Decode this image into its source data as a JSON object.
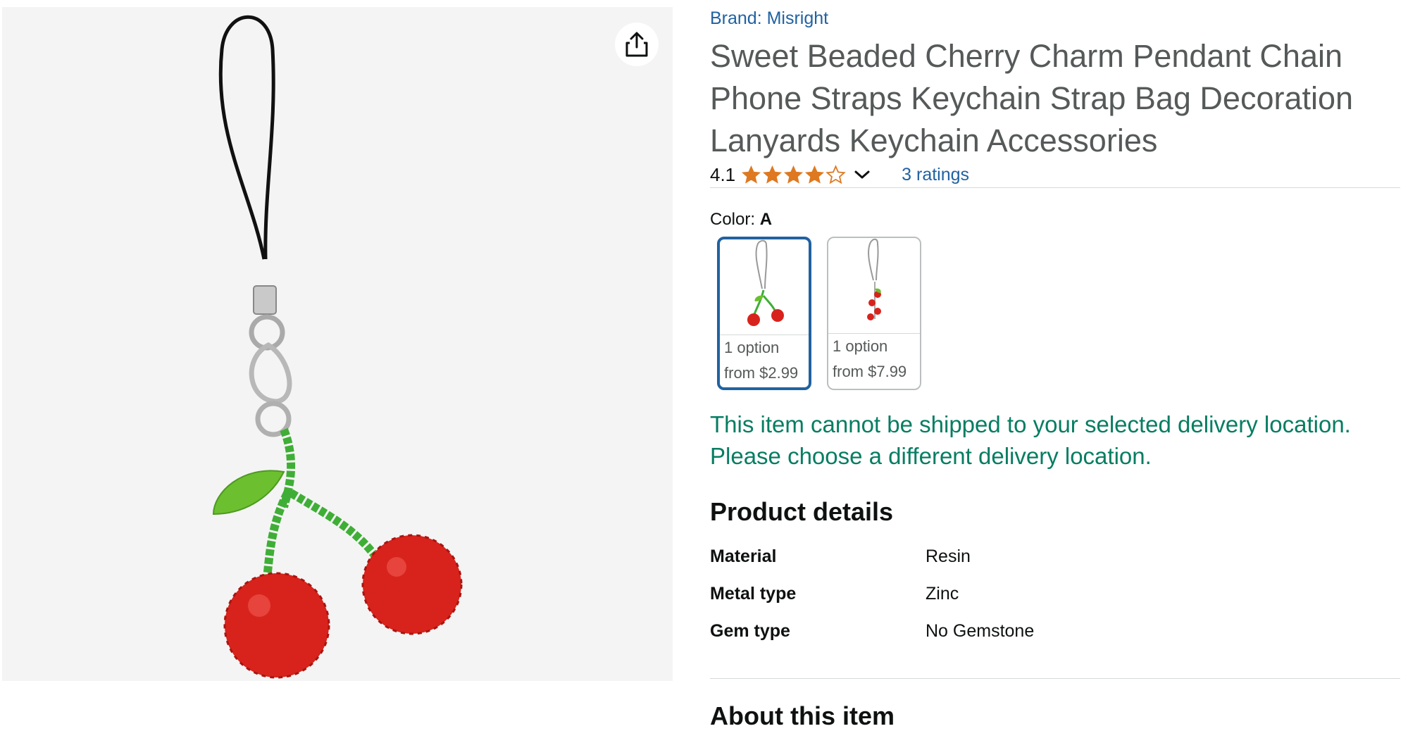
{
  "product": {
    "brand": "Brand: Misright",
    "title": "Sweet Beaded Cherry Charm Pendant Chain Phone Straps Keychain Strap Bag Decoration Lanyards Keychain Accessories",
    "rating": "4.1",
    "stars_filled": 4,
    "stars_total": 5,
    "ratings_count": "3 ratings"
  },
  "color": {
    "label": "Color:",
    "selected": "A",
    "swatches": [
      {
        "options": "1 option",
        "price": "from $2.99",
        "selected": true
      },
      {
        "options": "1 option",
        "price": "from $7.99",
        "selected": false
      }
    ]
  },
  "shipping": {
    "line1": "This item cannot be shipped to your selected delivery location.",
    "line2": "Please choose a different delivery location."
  },
  "product_details": {
    "heading": "Product details",
    "rows": [
      {
        "key": "Material",
        "value": "Resin"
      },
      {
        "key": "Metal type",
        "value": "Zinc"
      },
      {
        "key": "Gem type",
        "value": "No Gemstone"
      }
    ]
  },
  "about": {
    "heading": "About this item"
  },
  "icons": {
    "share": "share-icon",
    "chevron": "chevron-down-icon",
    "star": "star-icon"
  },
  "colors": {
    "link": "#2162a1",
    "title": "#565959",
    "star": "#de7921",
    "success": "#067d62",
    "selected_border": "#2162a1"
  }
}
